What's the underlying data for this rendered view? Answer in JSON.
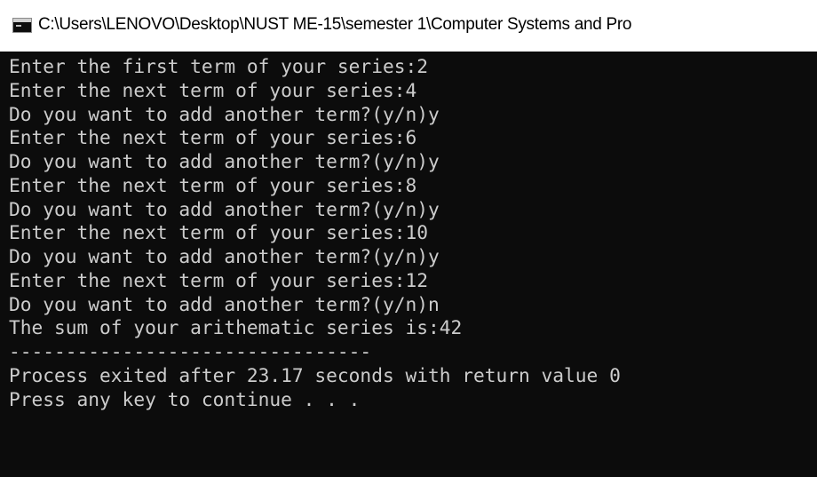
{
  "window": {
    "title": "C:\\Users\\LENOVO\\Desktop\\NUST ME-15\\semester 1\\Computer Systems and Pro",
    "icon": "console-window-icon"
  },
  "console": {
    "lines": [
      "Enter the first term of your series:2",
      "Enter the next term of your series:4",
      "Do you want to add another term?(y/n)y",
      "Enter the next term of your series:6",
      "Do you want to add another term?(y/n)y",
      "Enter the next term of your series:8",
      "Do you want to add another term?(y/n)y",
      "Enter the next term of your series:10",
      "Do you want to add another term?(y/n)y",
      "Enter the next term of your series:12",
      "Do you want to add another term?(y/n)n",
      "The sum of your arithematic series is:42",
      "--------------------------------",
      "Process exited after 23.17 seconds with return value 0",
      "Press any key to continue . . ."
    ]
  },
  "colors": {
    "background": "#0c0c0c",
    "text": "#cccccc",
    "titlebar": "#ffffff"
  }
}
